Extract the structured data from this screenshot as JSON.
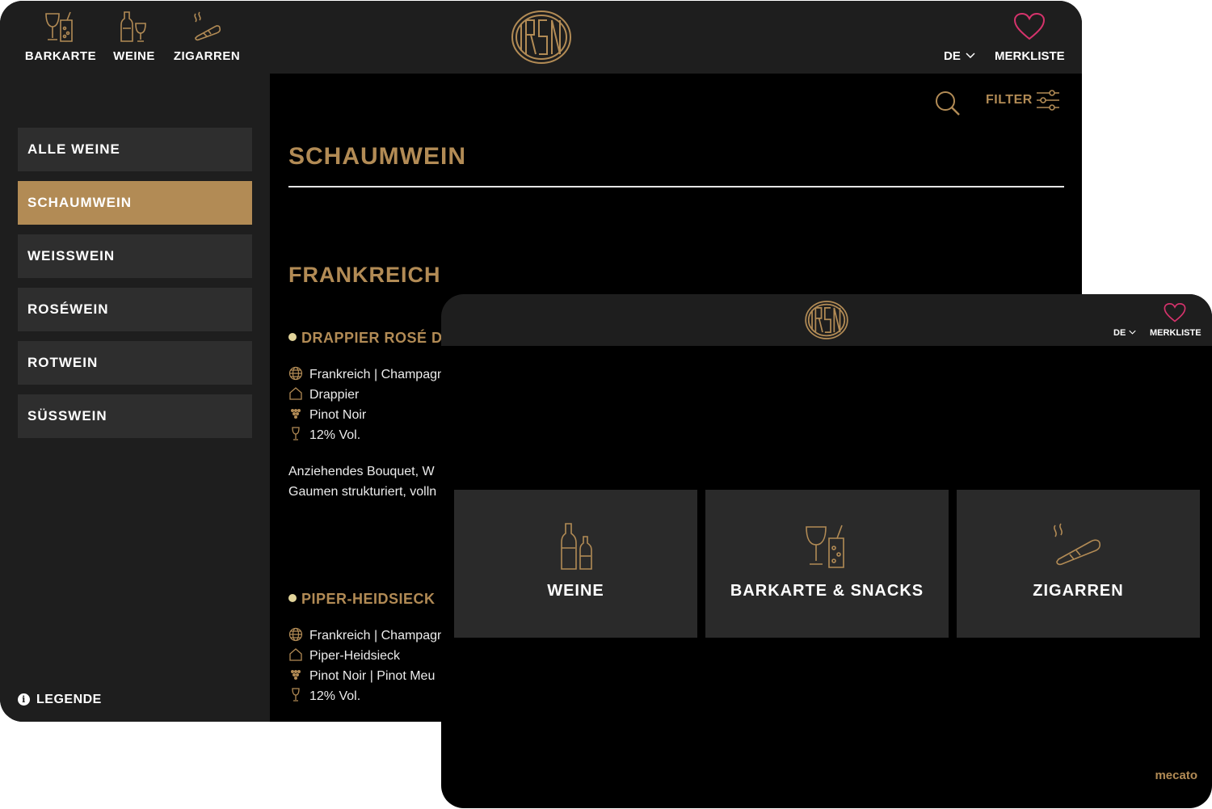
{
  "back": {
    "nav": [
      {
        "label": "BARKARTE",
        "icon": "cocktail-glasses-icon"
      },
      {
        "label": "WEINE",
        "icon": "wine-bottle-glass-icon"
      },
      {
        "label": "ZIGARREN",
        "icon": "cigar-icon"
      }
    ],
    "lang": "DE",
    "merkliste": "MERKLISTE",
    "categories": [
      "ALLE WEINE",
      "SCHAUMWEIN",
      "WEISSWEIN",
      "ROSÉWEIN",
      "ROTWEIN",
      "SÜSSWEIN"
    ],
    "active_category": "SCHAUMWEIN",
    "legend": "LEGENDE",
    "filter": "FILTER",
    "section_title": "SCHAUMWEIN",
    "region": "FRANKREICH",
    "wines": [
      {
        "name": "DRAPPIER ROSÉ D",
        "origin": "Frankreich | Champagn",
        "producer": "Drappier",
        "grape": "Pinot Noir",
        "alcohol": "12% Vol.",
        "desc_line1": "Anziehendes Bouquet, W",
        "desc_line2": "Gaumen strukturiert, volln"
      },
      {
        "name": "PIPER-HEIDSIECK",
        "origin": "Frankreich | Champagn",
        "producer": "Piper-Heidsieck",
        "grape": "Pinot Noir | Pinot Meu",
        "alcohol": "12% Vol."
      }
    ]
  },
  "front": {
    "lang": "DE",
    "merkliste": "MERKLISTE",
    "tiles": [
      {
        "label": "WEINE",
        "icon": "wine-bottles-icon"
      },
      {
        "label": "BARKARTE & SNACKS",
        "icon": "cocktail-glasses-icon"
      },
      {
        "label": "ZIGARREN",
        "icon": "cigar-icon"
      }
    ],
    "brand": "mecato"
  },
  "colors": {
    "accent": "#b28b55",
    "heart": "#d6336c",
    "bar": "#1e1e1e",
    "tile": "#2a2a2a"
  }
}
